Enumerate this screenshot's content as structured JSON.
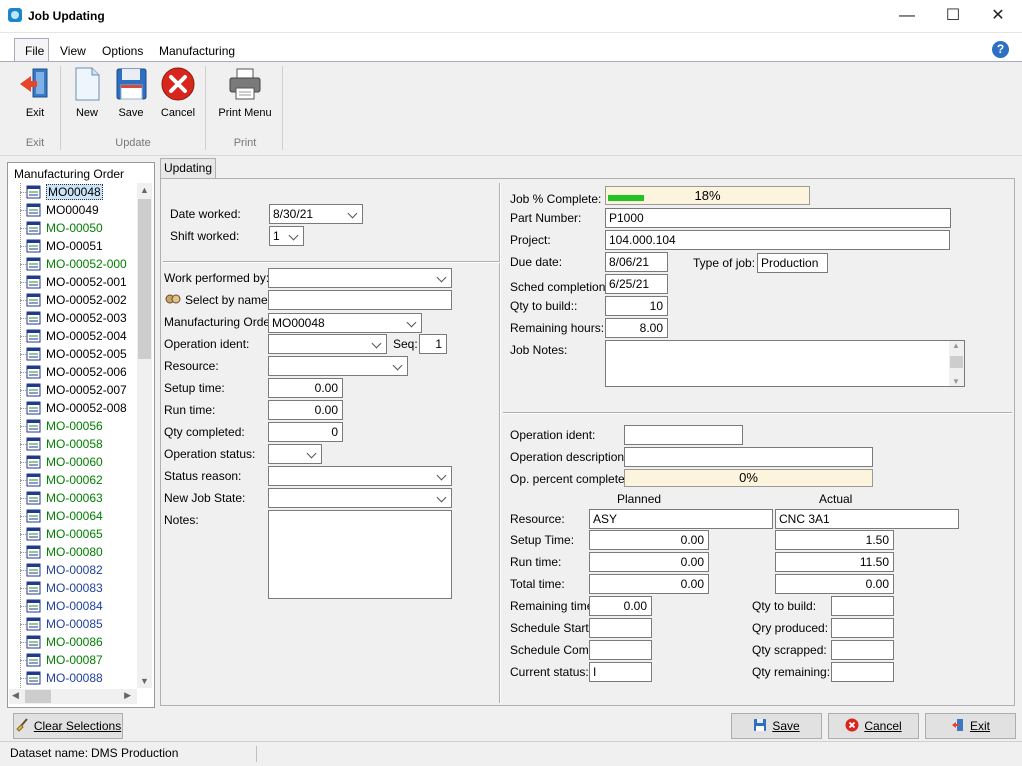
{
  "window": {
    "title": "Job Updating"
  },
  "menu": {
    "file": "File",
    "view": "View",
    "options": "Options",
    "manufacturing": "Manufacturing"
  },
  "ribbon": {
    "exit": "Exit",
    "new": "New",
    "save": "Save",
    "cancel": "Cancel",
    "print_menu": "Print Menu",
    "groups": {
      "exit": "Exit",
      "update": "Update",
      "print": "Print"
    }
  },
  "tree": {
    "title": "Manufacturing Order",
    "items": [
      {
        "label": "MO00048",
        "color": "#000000"
      },
      {
        "label": "MO00049",
        "color": "#000000"
      },
      {
        "label": "MO-00050",
        "color": "#008000"
      },
      {
        "label": "MO-00051",
        "color": "#000000"
      },
      {
        "label": "MO-00052-000",
        "color": "#008000"
      },
      {
        "label": "MO-00052-001",
        "color": "#000000"
      },
      {
        "label": "MO-00052-002",
        "color": "#000000"
      },
      {
        "label": "MO-00052-003",
        "color": "#000000"
      },
      {
        "label": "MO-00052-004",
        "color": "#000000"
      },
      {
        "label": "MO-00052-005",
        "color": "#000000"
      },
      {
        "label": "MO-00052-006",
        "color": "#000000"
      },
      {
        "label": "MO-00052-007",
        "color": "#000000"
      },
      {
        "label": "MO-00052-008",
        "color": "#000000"
      },
      {
        "label": "MO-00056",
        "color": "#008000"
      },
      {
        "label": "MO-00058",
        "color": "#008000"
      },
      {
        "label": "MO-00060",
        "color": "#008000"
      },
      {
        "label": "MO-00062",
        "color": "#008000"
      },
      {
        "label": "MO-00063",
        "color": "#008000"
      },
      {
        "label": "MO-00064",
        "color": "#008000"
      },
      {
        "label": "MO-00065",
        "color": "#008000"
      },
      {
        "label": "MO-00080",
        "color": "#008000"
      },
      {
        "label": "MO-00082",
        "color": "#2040a0"
      },
      {
        "label": "MO-00083",
        "color": "#2040a0"
      },
      {
        "label": "MO-00084",
        "color": "#2040a0"
      },
      {
        "label": "MO-00085",
        "color": "#2040a0"
      },
      {
        "label": "MO-00086",
        "color": "#008000"
      },
      {
        "label": "MO-00087",
        "color": "#008000"
      },
      {
        "label": "MO-00088",
        "color": "#2040a0"
      }
    ]
  },
  "tab": {
    "updating": "Updating"
  },
  "left": {
    "date_worked_label": "Date worked:",
    "date_worked": "8/30/21",
    "shift_worked_label": "Shift worked:",
    "shift_worked": "1",
    "work_performed_label": "Work performed by:",
    "work_performed": "",
    "select_by_name_label": "Select by name",
    "select_by_name": "",
    "mo_label": "Manufacturing Order:",
    "mo": "MO00048",
    "op_ident_label": "Operation ident:",
    "op_ident": "",
    "seq_label": "Seq:",
    "seq": "1",
    "resource_label": "Resource:",
    "resource": "",
    "setup_label": "Setup time:",
    "setup": "0.00",
    "run_label": "Run time:",
    "run": "0.00",
    "qty_completed_label": "Qty completed:",
    "qty_completed": "0",
    "op_status_label": "Operation status:",
    "op_status": "",
    "status_reason_label": "Status reason:",
    "status_reason": "",
    "new_job_state_label": "New Job State:",
    "new_job_state": "",
    "notes_label": "Notes:",
    "notes": ""
  },
  "job": {
    "pct_label": "Job % Complete:",
    "pct_text": "18%",
    "pct_value": 0.18,
    "part_label": "Part Number:",
    "part": "P1000",
    "project_label": "Project:",
    "project": "104.000.104",
    "due_label": "Due date:",
    "due": "8/06/21",
    "type_label": "Type of job:",
    "type": "Production",
    "sched_label": "Sched completion:",
    "sched": "6/25/21",
    "qty_label": "Qty to build::",
    "qty": "10",
    "remaining_label": "Remaining hours:",
    "remaining": "8.00",
    "notes_label": "Job Notes:",
    "notes": ""
  },
  "op": {
    "ident_label": "Operation ident:",
    "ident": "",
    "desc_label": "Operation description:",
    "desc": "",
    "pct_label": "Op. percent complete:",
    "pct_text": "0%",
    "planned_header": "Planned",
    "actual_header": "Actual",
    "resource_label": "Resource:",
    "resource_planned": "ASY",
    "resource_actual": "CNC 3A1",
    "setup_label": "Setup Time:",
    "setup_planned": "0.00",
    "setup_actual": "1.50",
    "run_label": "Run time:",
    "run_planned": "0.00",
    "run_actual": "11.50",
    "total_label": "Total time:",
    "total_planned": "0.00",
    "total_actual": "0.00",
    "remaining_label": "Remaining time:",
    "remaining": "0.00",
    "sched_start_label": "Schedule Start:",
    "sched_start": "",
    "sched_comp_label": "Schedule Comp:",
    "sched_comp": "",
    "current_status_label": "Current status:",
    "current_status": "I",
    "qty_build_label": "Qty to build:",
    "qty_build": "",
    "qty_produced_label": "Qry produced:",
    "qty_produced": "",
    "qty_scrapped_label": "Qty scrapped:",
    "qty_scrapped": "",
    "qty_remaining_label": "Qty remaining:",
    "qty_remaining": ""
  },
  "buttons": {
    "clear": "Clear Selections",
    "save": "Save",
    "cancel": "Cancel",
    "exit": "Exit"
  },
  "status": {
    "dataset_label": "Dataset name:",
    "dataset": "DMS Production"
  },
  "colors": {
    "progress": "#22c322",
    "accent": "#1a73c8"
  }
}
